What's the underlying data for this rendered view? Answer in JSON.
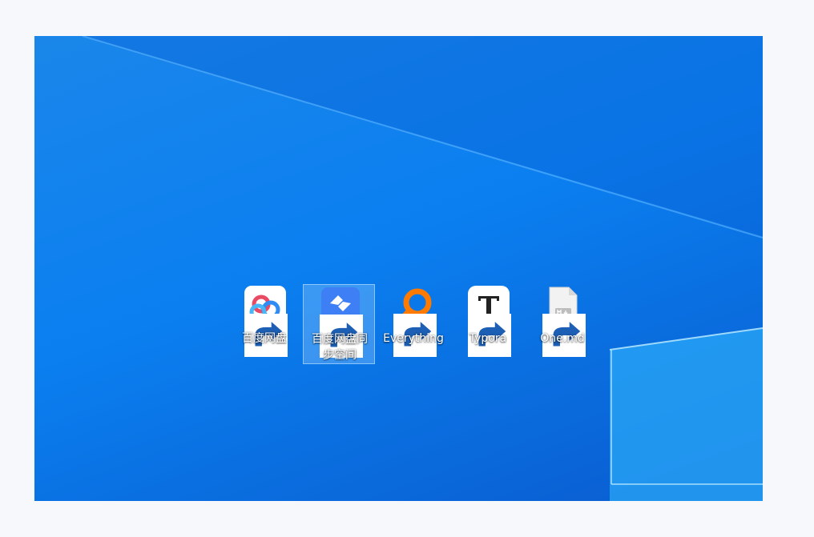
{
  "desktop": {
    "icons": [
      {
        "label": "百度网盘",
        "icon": "baidu-netdisk-icon",
        "shortcut": true,
        "selected": false
      },
      {
        "label": "百度网盘同步空间",
        "icon": "baidu-sync-space-icon",
        "shortcut": true,
        "selected": true
      },
      {
        "label": "Everything",
        "icon": "everything-search-icon",
        "shortcut": true,
        "selected": false
      },
      {
        "label": "Typora",
        "icon": "typora-icon",
        "shortcut": true,
        "selected": false
      },
      {
        "label": "One.md",
        "icon": "markdown-file-icon",
        "shortcut": true,
        "selected": false
      }
    ]
  },
  "colors": {
    "wallpaper": "#0b7ff0",
    "selection": "#8cc8ff",
    "everything_orange": "#ff7a00"
  }
}
